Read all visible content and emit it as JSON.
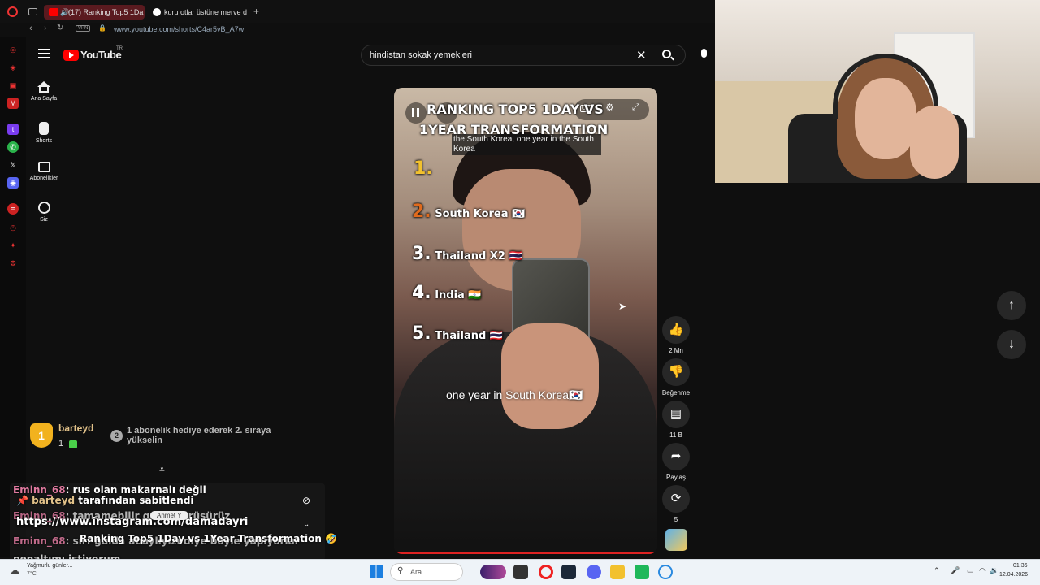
{
  "browser": {
    "tabs": [
      {
        "label": "(17) Ranking Top5 1Da"
      },
      {
        "label": "kuru otlar üstüne merve d"
      }
    ],
    "new_tab": "+",
    "vpn": "VPN",
    "url": "www.youtube.com/shorts/C4ar5vB_A7w"
  },
  "youtube": {
    "logo": "YouTube",
    "region": "TR",
    "search_value": "hindistan sokak yemekleri",
    "nav": [
      {
        "label": "Ana Sayfa",
        "icon": "home-icon"
      },
      {
        "label": "Shorts",
        "icon": "shorts-icon"
      },
      {
        "label": "Abonelikler",
        "icon": "subscriptions-icon"
      },
      {
        "label": "Siz",
        "icon": "you-icon"
      }
    ]
  },
  "video": {
    "title_line1": "RANKING TOP5 1DAY VS",
    "title_line2": "1YEAR TRANSFORMATION",
    "caption_top": "the South Korea, one year in the South Korea",
    "ranks": [
      {
        "num": "1.",
        "text": ""
      },
      {
        "num": "2.",
        "text": "South Korea 🇰🇷"
      },
      {
        "num": "3.",
        "text": "Thailand X2 🇹🇭"
      },
      {
        "num": "4.",
        "text": "India 🇮🇳"
      },
      {
        "num": "5.",
        "text": "Thailand 🇹🇭"
      }
    ],
    "subtitle": "one year in South Korea🇰🇷",
    "cc": "CC",
    "progress": 0.0
  },
  "actions": {
    "like_count": "2 Mn",
    "dislike_label": "Beğenme",
    "comments_count": "11 B",
    "share_label": "Paylaş",
    "remix_count": "5"
  },
  "chat": {
    "top_user": "barteyd",
    "top_rank": "1",
    "top_count": "1",
    "gift_rank": "2",
    "gift_text": "1 abonelik hediye ederek 2. sıraya yükselin",
    "lines": [
      {
        "user": "Eminn_68",
        "text": ": rus olan makarnalı değil"
      },
      {
        "user": "barteyd",
        "text": "tarafından sabitlendi"
      },
      {
        "user": "Eminn_68",
        "text": ": tamamebilir gu ... görüşürüz"
      },
      {
        "user": "",
        "text": "https://www.instagram.com/damadayri"
      },
      {
        "user": "Eminn_68",
        "text": ": sırf gülda abaylıyızı diye böyle yapıyorlar"
      },
      {
        "user": "",
        "text": "penaltımı istiyorum"
      },
      {
        "user": "Eminn_68",
        "text": ""
      }
    ],
    "pinned_title": "Ranking Top5 1Day vs 1Year Transformation 🤣",
    "hide_label": "Ahmet Y"
  },
  "taskbar": {
    "weather": "Yağmurlu günler...",
    "temp": "7°C",
    "search_placeholder": "Ara",
    "time": "01:36",
    "date": "12.04.2026"
  }
}
